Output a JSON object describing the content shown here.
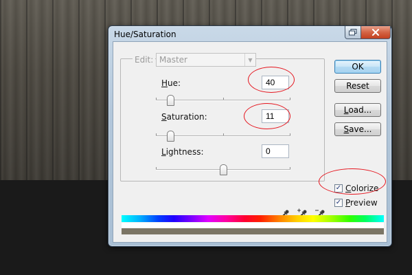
{
  "window": {
    "title": "Hue/Saturation"
  },
  "edit": {
    "label": "Edit:",
    "selected": "Master"
  },
  "hue": {
    "label_first": "H",
    "label_rest": "ue:",
    "value": "40"
  },
  "saturation": {
    "label_first": "S",
    "label_rest": "aturation:",
    "value": "11"
  },
  "lightness": {
    "label_first": "L",
    "label_rest": "ightness:",
    "value": "0"
  },
  "buttons": {
    "ok": "OK",
    "reset": "Reset",
    "load_first": "L",
    "load_rest": "oad...",
    "save_first": "S",
    "save_rest": "ave..."
  },
  "options": {
    "colorize_first": "C",
    "colorize_rest": "olorize",
    "colorize_checked": true,
    "preview_first": "P",
    "preview_rest": "review",
    "preview_checked": true,
    "check_glyph": "✓"
  },
  "colors": {
    "annotation": "#e5131c",
    "result_bar": "#7b7565",
    "accent": "#3c7fb1"
  },
  "icons": [
    "restore-icon",
    "close-icon",
    "chevron-down-icon",
    "eyedropper-icon",
    "eyedropper-plus-icon",
    "eyedropper-minus-icon"
  ]
}
